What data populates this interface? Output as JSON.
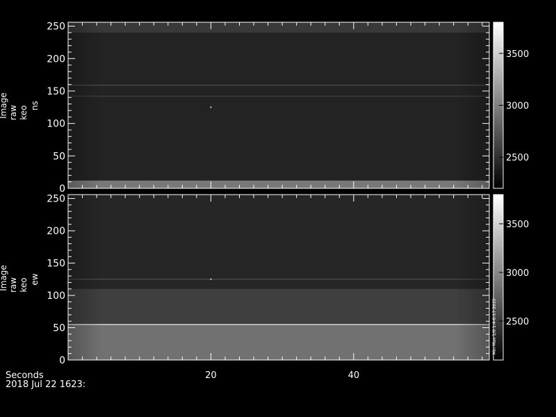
{
  "chart_data": [
    {
      "type": "heatmap",
      "ylabel_lines": [
        "Image",
        "raw",
        "keo",
        "ns"
      ],
      "x_ticks": [
        20,
        40
      ],
      "y_ticks": [
        0,
        50,
        100,
        150,
        200,
        250
      ],
      "xlim": [
        0,
        59
      ],
      "ylim": [
        0,
        256
      ],
      "colorbar": {
        "range": [
          2200,
          3800
        ],
        "ticks": [
          2500,
          3000,
          3500
        ]
      },
      "background_level": 2420,
      "features": [
        {
          "kind": "bright_band",
          "y_from": 0,
          "y_to": 12,
          "level": 2950
        },
        {
          "kind": "horizontal_line",
          "y": 159,
          "level": 2650
        },
        {
          "kind": "horizontal_line",
          "y": 142,
          "level": 2580
        },
        {
          "kind": "bright_band",
          "y_from": 240,
          "y_to": 256,
          "level": 2560
        },
        {
          "kind": "bright_pixel",
          "x": 20,
          "y": 125,
          "level": 3500
        }
      ],
      "side_annotation": ""
    },
    {
      "type": "heatmap",
      "ylabel_lines": [
        "Image",
        "raw",
        "keo",
        "ew"
      ],
      "x_ticks": [
        20,
        40
      ],
      "y_ticks": [
        0,
        50,
        100,
        150,
        200,
        250
      ],
      "xlim": [
        0,
        59
      ],
      "ylim": [
        0,
        256
      ],
      "colorbar": {
        "range": [
          2100,
          3800
        ],
        "ticks": [
          2500,
          3000,
          3500
        ]
      },
      "background_level": 2350,
      "features": [
        {
          "kind": "bright_band",
          "y_from": 0,
          "y_to": 55,
          "level": 2850
        },
        {
          "kind": "gradient_band",
          "y_from": 55,
          "y_to": 110,
          "level": 2650
        },
        {
          "kind": "horizontal_line",
          "y": 55,
          "level": 3500
        },
        {
          "kind": "horizontal_line",
          "y": 125,
          "level": 2560
        },
        {
          "kind": "bright_pixel",
          "x": 20,
          "y": 125,
          "level": 3500
        }
      ],
      "side_annotation": "Min Max 1/6 1.4-6-17 2035"
    }
  ],
  "footer": {
    "xlabel": "Seconds",
    "timestamp": "2018 Jul 22 1623:"
  }
}
